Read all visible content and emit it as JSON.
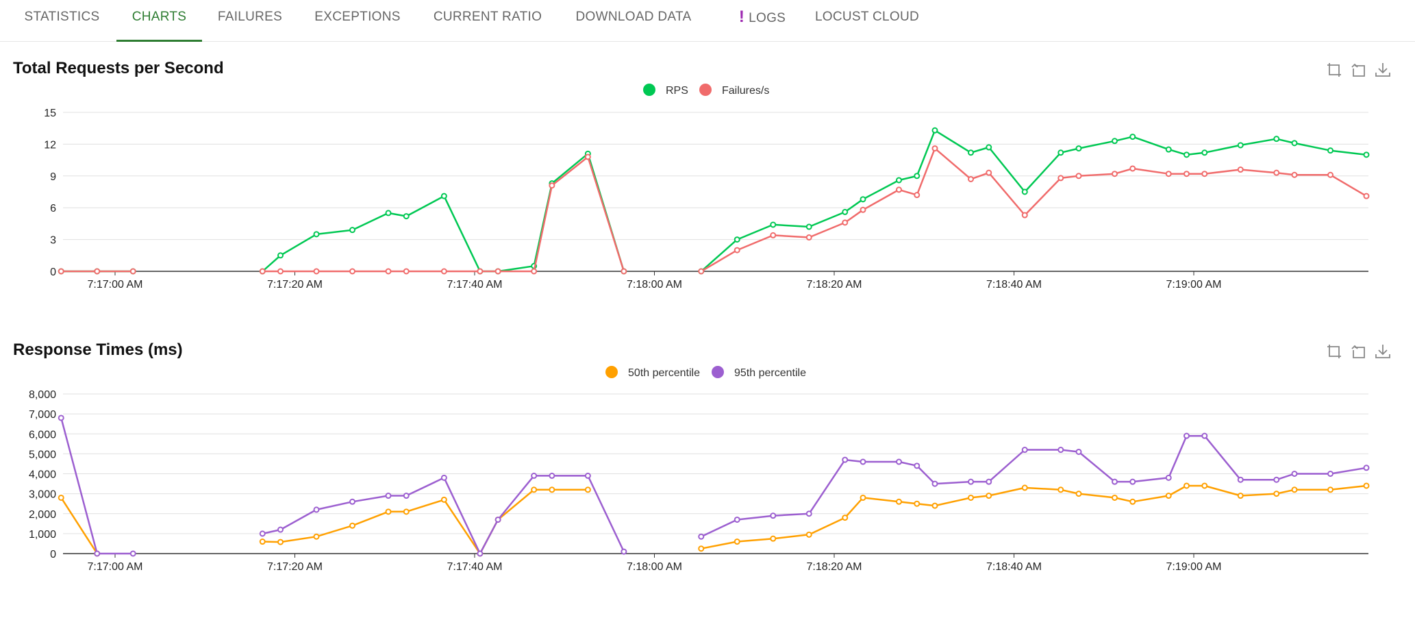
{
  "tabs": [
    {
      "label": "STATISTICS",
      "active": false
    },
    {
      "label": "CHARTS",
      "active": true
    },
    {
      "label": "FAILURES",
      "active": false
    },
    {
      "label": "EXCEPTIONS",
      "active": false
    },
    {
      "label": "CURRENT RATIO",
      "active": false
    },
    {
      "label": "DOWNLOAD DATA",
      "active": false
    },
    {
      "label": "LOGS",
      "active": false,
      "alert": "!"
    },
    {
      "label": "LOCUST CLOUD",
      "active": false
    }
  ],
  "toolbox_icons": [
    "zoom-icon",
    "restore-icon",
    "download-icon"
  ],
  "chart_data": [
    {
      "type": "line",
      "title": "Total Requests per Second",
      "ylim": [
        0,
        15
      ],
      "y_ticks": [
        "0",
        "3",
        "6",
        "9",
        "12",
        "15"
      ],
      "x_tick_labels": [
        "7:17:00 AM",
        "7:17:20 AM",
        "7:17:40 AM",
        "7:18:00 AM",
        "7:18:20 AM",
        "7:18:40 AM",
        "7:19:00 AM"
      ],
      "x_tick_seconds": [
        0,
        20,
        40,
        60,
        80,
        100,
        120
      ],
      "legend_position": "top-center",
      "grid": true,
      "series": [
        {
          "name": "RPS",
          "color": "#00c853",
          "x": [
            -6,
            -2,
            2,
            null,
            16.4,
            18.4,
            22.4,
            26.4,
            30.4,
            32.4,
            36.6,
            40.6,
            42.6,
            46.6,
            48.6,
            52.6,
            56.6,
            null,
            65.2,
            69.2,
            73.2,
            77.2,
            81.2,
            83.2,
            87.2,
            89.2,
            91.2,
            95.2,
            97.2,
            101.2,
            105.2,
            107.2,
            111.2,
            113.2,
            117.2,
            119.2,
            121.2,
            125.2,
            129.2,
            131.2,
            135.2,
            139.2
          ],
          "y": [
            0,
            0,
            0,
            null,
            0,
            1.5,
            3.5,
            3.9,
            5.5,
            5.2,
            7.1,
            0,
            0,
            0.5,
            8.3,
            11.1,
            0,
            null,
            0,
            3,
            4.4,
            4.2,
            5.6,
            6.8,
            8.6,
            9,
            13.3,
            11.2,
            11.7,
            7.5,
            11.2,
            11.6,
            12.3,
            12.7,
            11.5,
            11,
            11.2,
            11.9,
            12.5,
            12.1,
            11.4,
            11
          ]
        },
        {
          "name": "Failures/s",
          "color": "#f06b6b",
          "x": [
            -6,
            -2,
            2,
            null,
            16.4,
            18.4,
            22.4,
            26.4,
            30.4,
            32.4,
            36.6,
            40.6,
            42.6,
            46.6,
            48.6,
            52.6,
            56.6,
            null,
            65.2,
            69.2,
            73.2,
            77.2,
            81.2,
            83.2,
            87.2,
            89.2,
            91.2,
            95.2,
            97.2,
            101.2,
            105.2,
            107.2,
            111.2,
            113.2,
            117.2,
            119.2,
            121.2,
            125.2,
            129.2,
            131.2,
            135.2,
            139.2
          ],
          "y": [
            0,
            0,
            0,
            null,
            0,
            0,
            0,
            0,
            0,
            0,
            0,
            0,
            0,
            0,
            8.1,
            10.8,
            0,
            null,
            0,
            2,
            3.4,
            3.2,
            4.6,
            5.8,
            7.7,
            7.2,
            11.6,
            8.7,
            9.3,
            5.3,
            8.8,
            9,
            9.2,
            9.7,
            9.2,
            9.2,
            9.2,
            9.6,
            9.3,
            9.1,
            9.1,
            7.1
          ]
        }
      ]
    },
    {
      "type": "line",
      "title": "Response Times (ms)",
      "ylim": [
        0,
        8000
      ],
      "y_ticks": [
        "0",
        "1,000",
        "2,000",
        "3,000",
        "4,000",
        "5,000",
        "6,000",
        "7,000",
        "8,000"
      ],
      "x_tick_labels": [
        "7:17:00 AM",
        "7:17:20 AM",
        "7:17:40 AM",
        "7:18:00 AM",
        "7:18:20 AM",
        "7:18:40 AM",
        "7:19:00 AM"
      ],
      "x_tick_seconds": [
        0,
        20,
        40,
        60,
        80,
        100,
        120
      ],
      "legend_position": "top-center",
      "grid": true,
      "series": [
        {
          "name": "50th percentile",
          "color": "#ffa000",
          "x": [
            -6,
            -2,
            null,
            16.4,
            18.4,
            22.4,
            26.4,
            30.4,
            32.4,
            36.6,
            40.6,
            42.6,
            46.6,
            48.6,
            52.6,
            null,
            65.2,
            69.2,
            73.2,
            77.2,
            81.2,
            83.2,
            87.2,
            89.2,
            91.2,
            95.2,
            97.2,
            101.2,
            105.2,
            107.2,
            111.2,
            113.2,
            117.2,
            119.2,
            121.2,
            125.2,
            129.2,
            131.2,
            135.2,
            139.2
          ],
          "y": [
            2800,
            0,
            null,
            600,
            580,
            850,
            1400,
            2100,
            2100,
            2700,
            0,
            1700,
            3200,
            3200,
            3200,
            null,
            250,
            600,
            750,
            950,
            1800,
            2800,
            2600,
            2500,
            2400,
            2800,
            2900,
            3300,
            3200,
            3000,
            2800,
            2600,
            2900,
            3400,
            3400,
            2900,
            3000,
            3200,
            3200,
            3400
          ]
        },
        {
          "name": "95th percentile",
          "color": "#9c5fd0",
          "x": [
            -6,
            -2,
            2,
            null,
            16.4,
            18.4,
            22.4,
            26.4,
            30.4,
            32.4,
            36.6,
            40.6,
            42.6,
            46.6,
            48.6,
            52.6,
            56.6,
            null,
            65.2,
            69.2,
            73.2,
            77.2,
            81.2,
            83.2,
            87.2,
            89.2,
            91.2,
            95.2,
            97.2,
            101.2,
            105.2,
            107.2,
            111.2,
            113.2,
            117.2,
            119.2,
            121.2,
            125.2,
            129.2,
            131.2,
            135.2,
            139.2
          ],
          "y": [
            6800,
            0,
            0,
            null,
            1000,
            1200,
            2200,
            2600,
            2900,
            2900,
            3800,
            0,
            1700,
            3900,
            3900,
            3900,
            100,
            null,
            850,
            1700,
            1900,
            2000,
            4700,
            4600,
            4600,
            4400,
            3500,
            3600,
            3600,
            5200,
            5200,
            5100,
            3600,
            3600,
            3800,
            5900,
            5900,
            3700,
            3700,
            4000,
            4000,
            4300
          ]
        }
      ]
    }
  ]
}
